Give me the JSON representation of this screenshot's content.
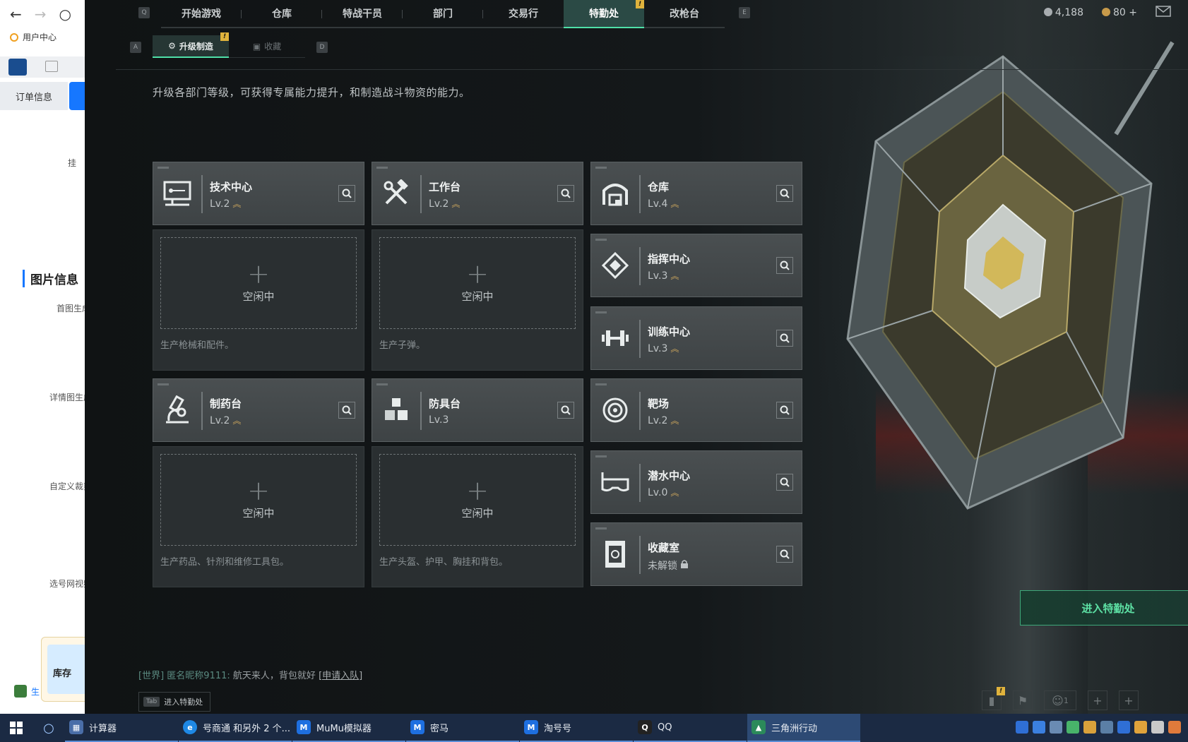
{
  "browser": {
    "bookmark": "用户中心",
    "order_tab": "订单信息",
    "labels": [
      "挂",
      "首图生成",
      "详情图生成",
      "自定义裁剪",
      "选号网视频"
    ],
    "section_title": "图片信息",
    "stock_label": "库存",
    "footer_text": "生"
  },
  "topnav": {
    "key_left": "Q",
    "key_right": "E",
    "tabs": [
      "开始游戏",
      "仓库",
      "特战干员",
      "部门",
      "交易行",
      "特勤处",
      "改枪台"
    ],
    "active_tab": "特勤处",
    "warn": "!",
    "currency_silver": "4,188",
    "currency_gold": "80",
    "plus": "+"
  },
  "subnav": {
    "key_left": "A",
    "key_right": "D",
    "tab_upgrade": "升级制造",
    "tab_collect": "收藏"
  },
  "description": "升级各部门等级，可获得专属能力提升，和制造战斗物资的能力。",
  "production": [
    {
      "name": "技术中心",
      "level": "Lv.2",
      "upgradable": true,
      "icon": "computer-icon",
      "idle": "空闲中",
      "caption": "生产枪械和配件。"
    },
    {
      "name": "工作台",
      "level": "Lv.2",
      "upgradable": true,
      "icon": "hammer-wrench-icon",
      "idle": "空闲中",
      "caption": "生产子弹。"
    },
    {
      "name": "制药台",
      "level": "Lv.2",
      "upgradable": true,
      "icon": "microscope-icon",
      "idle": "空闲中",
      "caption": "生产药品、针剂和维修工具包。"
    },
    {
      "name": "防具台",
      "level": "Lv.3",
      "upgradable": false,
      "icon": "cubes-icon",
      "idle": "空闲中",
      "caption": "生产头盔、护甲、胸挂和背包。"
    }
  ],
  "facilities": [
    {
      "name": "仓库",
      "level": "Lv.4",
      "upgradable": true,
      "icon": "warehouse-icon"
    },
    {
      "name": "指挥中心",
      "level": "Lv.3",
      "upgradable": true,
      "icon": "command-diamond-icon"
    },
    {
      "name": "训练中心",
      "level": "Lv.3",
      "upgradable": true,
      "icon": "dumbbell-icon"
    },
    {
      "name": "靶场",
      "level": "Lv.2",
      "upgradable": true,
      "icon": "target-icon"
    },
    {
      "name": "潜水中心",
      "level": "Lv.0",
      "upgradable": true,
      "icon": "diving-mask-icon"
    },
    {
      "name": "收藏室",
      "level": "未解锁",
      "upgradable": false,
      "locked": true,
      "icon": "collection-room-icon"
    }
  ],
  "up_symbol": "︽",
  "chat": {
    "channel": "[世界]",
    "sender": "匿名昵称9111:",
    "message": "航天来人，背包就好",
    "link": "[申请入队]"
  },
  "tab_hint": {
    "key": "Tab",
    "label": "进入特勤处"
  },
  "enter_button": "进入特勤处",
  "bottom_friend_count": "1",
  "taskbar": [
    {
      "label": "计算器",
      "color": "#4a6ea8",
      "glyph": "▦"
    },
    {
      "label": "号商通 和另外 2 个...",
      "color": "#1e88e5",
      "glyph": "e"
    },
    {
      "label": "MuMu模拟器",
      "color": "#1e6fe0",
      "glyph": "M"
    },
    {
      "label": "密马",
      "color": "#1e6fe0",
      "glyph": "M"
    },
    {
      "label": "淘号号",
      "color": "#1e6fe0",
      "glyph": "M"
    },
    {
      "label": "QQ",
      "color": "#222222",
      "glyph": "Q"
    },
    {
      "label": "三角洲行动",
      "color": "#2b8a5a",
      "glyph": "▲",
      "active": true
    }
  ]
}
